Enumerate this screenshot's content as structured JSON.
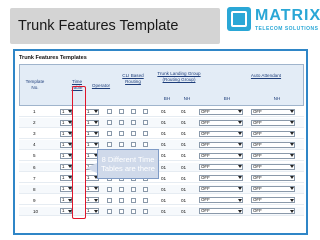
{
  "slide": {
    "title": "Trunk Features Template",
    "logo_name": "MATRIX",
    "logo_sub": "TELECOM SOLUTIONS"
  },
  "panel": {
    "title": "Trunk Features Templates",
    "headers": {
      "template_no": "Template No.",
      "time_table": "Time Table",
      "operator": "Operator",
      "cli_routing": "CLI Based Routing",
      "landing_group": "Trunk Landing Group (Routing Group)",
      "bh": "BH",
      "nh": "NH",
      "auto_attendant": "Auto Attendant",
      "bh2": "BH",
      "nh2": "NH"
    },
    "callout": "8 Different Time Tables are there",
    "rows": [
      {
        "no": "1",
        "time_table": "1",
        "operator": "1",
        "bh": "01",
        "nh": "01",
        "aa_bh": "OFF",
        "aa_nh": "OFF"
      },
      {
        "no": "2",
        "time_table": "1",
        "operator": "1",
        "bh": "01",
        "nh": "01",
        "aa_bh": "OFF",
        "aa_nh": "OFF"
      },
      {
        "no": "3",
        "time_table": "1",
        "operator": "1",
        "bh": "01",
        "nh": "01",
        "aa_bh": "OFF",
        "aa_nh": "OFF"
      },
      {
        "no": "4",
        "time_table": "1",
        "operator": "1",
        "bh": "01",
        "nh": "01",
        "aa_bh": "OFF",
        "aa_nh": "OFF"
      },
      {
        "no": "5",
        "time_table": "1",
        "operator": "1",
        "bh": "01",
        "nh": "01",
        "aa_bh": "OFF",
        "aa_nh": "OFF"
      },
      {
        "no": "6",
        "time_table": "1",
        "operator": "1",
        "bh": "01",
        "nh": "01",
        "aa_bh": "OFF",
        "aa_nh": "OFF"
      },
      {
        "no": "7",
        "time_table": "1",
        "operator": "1",
        "bh": "01",
        "nh": "01",
        "aa_bh": "OFF",
        "aa_nh": "OFF"
      },
      {
        "no": "8",
        "time_table": "1",
        "operator": "1",
        "bh": "01",
        "nh": "01",
        "aa_bh": "OFF",
        "aa_nh": "OFF"
      },
      {
        "no": "9",
        "time_table": "1",
        "operator": "1",
        "bh": "01",
        "nh": "01",
        "aa_bh": "OFF",
        "aa_nh": "OFF"
      },
      {
        "no": "10",
        "time_table": "1",
        "operator": "1",
        "bh": "01",
        "nh": "01",
        "aa_bh": "OFF",
        "aa_nh": "OFF"
      }
    ]
  },
  "colors": {
    "accent": "#2f86c7",
    "highlight": "#e0152a",
    "logo": "#2aa7d6"
  }
}
